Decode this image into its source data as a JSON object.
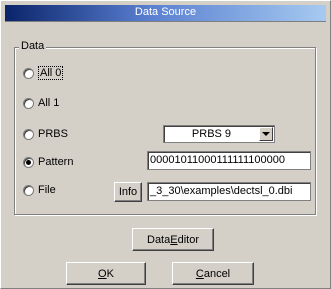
{
  "window": {
    "title": "Data Source"
  },
  "group": {
    "label": "Data"
  },
  "options": [
    {
      "label": "All 0",
      "checked": false
    },
    {
      "label": "All 1",
      "checked": false
    },
    {
      "label": "PRBS",
      "checked": false
    },
    {
      "label": "Pattern",
      "checked": true
    },
    {
      "label": "File",
      "checked": false
    }
  ],
  "prbs": {
    "selected": "PRBS 9"
  },
  "pattern": {
    "value": "00001011000111111100000"
  },
  "file": {
    "path": "_3_30\\examples\\dectsl_0.dbi",
    "info_label": "Info"
  },
  "buttons": {
    "data_editor_prefix": "Data ",
    "data_editor_mnemonic": "E",
    "data_editor_suffix": "ditor",
    "ok_mnemonic": "O",
    "ok_suffix": "K",
    "cancel_mnemonic": "C",
    "cancel_suffix": "ancel"
  },
  "colors": {
    "title_start": "#0a246a",
    "title_end": "#a6caf0",
    "face": "#d4d0c8"
  }
}
